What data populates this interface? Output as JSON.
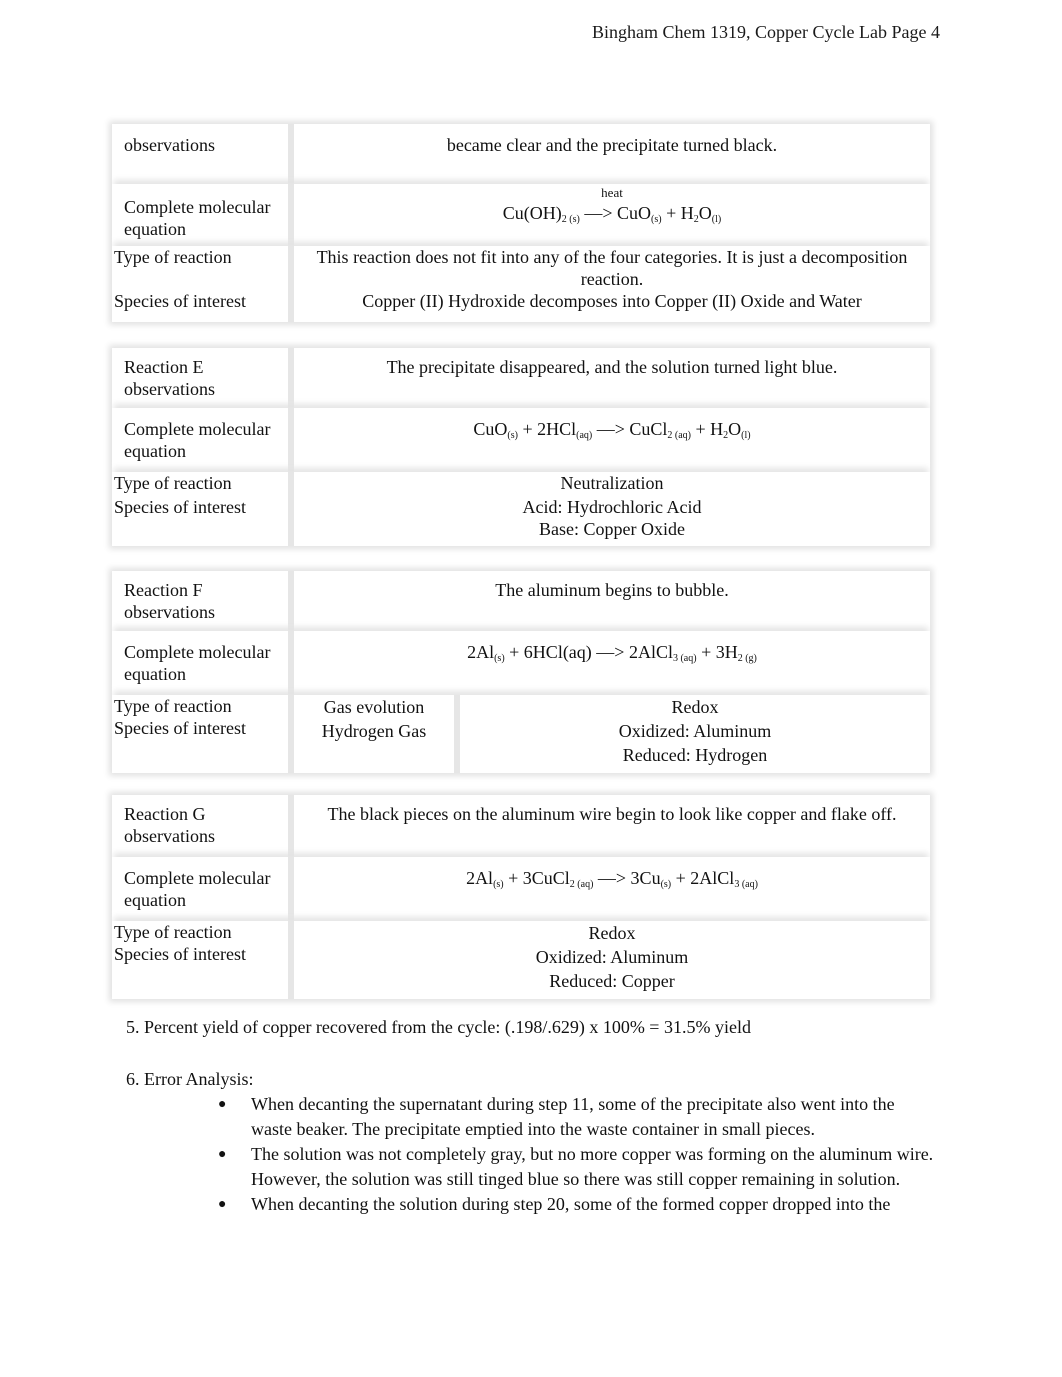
{
  "header": {
    "text": "Bingham Chem 1319, Copper Cycle Lab Page 4"
  },
  "tables": [
    {
      "id": "D",
      "rows": {
        "observations_label": "observations",
        "observations": "became clear and the precipitate turned black.",
        "equation_label": "Complete molecular equation",
        "equation_above": "heat",
        "equation": [
          {
            "t": "Cu(OH)"
          },
          {
            "s": "2 (s)"
          },
          {
            "t": " —> CuO"
          },
          {
            "s": "(s)"
          },
          {
            "t": " + H"
          },
          {
            "s": "2"
          },
          {
            "t": "O"
          },
          {
            "s": "(l)"
          }
        ],
        "type_label": "Type of reaction",
        "type": "This reaction does not fit into any of the four categories. It is just a decomposition reaction.",
        "species_label": "Species of interest",
        "species": [
          "Copper (II) Hydroxide decomposes into Copper (II) Oxide and Water"
        ]
      }
    },
    {
      "id": "E",
      "rows": {
        "observations_label": "Reaction E observations",
        "observations": "The precipitate disappeared, and the solution turned light blue.",
        "equation_label": "Complete molecular equation",
        "equation": [
          {
            "t": "CuO"
          },
          {
            "s": "(s)"
          },
          {
            "t": " + 2HCl"
          },
          {
            "s": "(aq)"
          },
          {
            "t": " —> CuCl"
          },
          {
            "s": "2 (aq)"
          },
          {
            "t": " + H"
          },
          {
            "s": "2"
          },
          {
            "t": "O"
          },
          {
            "s": "(l)"
          }
        ],
        "type_label": "Type of reaction",
        "type": "Neutralization",
        "species_label": "Species of interest",
        "species": [
          "Acid: Hydrochloric Acid",
          "Base: Copper Oxide"
        ]
      }
    },
    {
      "id": "F",
      "rows": {
        "observations_label": "Reaction F observations",
        "observations": "The aluminum begins to bubble.",
        "equation_label": "Complete molecular equation",
        "equation": [
          {
            "t": "2Al"
          },
          {
            "s": "(s)"
          },
          {
            "t": " + 6HCl(aq) —> 2AlCl"
          },
          {
            "s": "3 (aq)"
          },
          {
            "t": " + 3H"
          },
          {
            "s": "2 (g)"
          }
        ],
        "type_label": "Type of reaction",
        "type_left": "Gas evolution",
        "type_right": "Redox",
        "species_label": "Species of interest",
        "species_left": "Hydrogen Gas",
        "species_right": [
          "Oxidized: Aluminum",
          "Reduced: Hydrogen"
        ]
      }
    },
    {
      "id": "G",
      "rows": {
        "observations_label": "Reaction G observations",
        "observations": "The black pieces on the aluminum wire begin to look like copper and flake off.",
        "equation_label": "Complete molecular equation",
        "equation": [
          {
            "t": "2Al"
          },
          {
            "s": "(s)"
          },
          {
            "t": " + 3CuCl"
          },
          {
            "s": "2 (aq)"
          },
          {
            "t": " —> 3Cu"
          },
          {
            "s": "(s)"
          },
          {
            "t": " + 2AlCl"
          },
          {
            "s": "3 (aq)"
          }
        ],
        "type_label": "Type of reaction",
        "type": "Redox",
        "species_label": "Species of interest",
        "species": [
          "Oxidized: Aluminum",
          "Reduced: Copper"
        ]
      }
    }
  ],
  "percent_yield": {
    "text": "5. Percent yield of copper recovered from the cycle: (.198/.629) x 100% = 31.5% yield"
  },
  "error_analysis": {
    "heading": "6. Error Analysis:",
    "bullet_glyph": "●",
    "items": [
      "When decanting the supernatant during step 11, some of the precipitate also went into the waste beaker. The precipitate emptied into the waste container in small pieces.",
      "The solution was not completely gray, but no more copper was forming on the aluminum wire. However, the solution was still tinged blue so there was still copper remaining in solution.",
      "When decanting the solution during step 20, some of the formed copper dropped into the"
    ]
  }
}
